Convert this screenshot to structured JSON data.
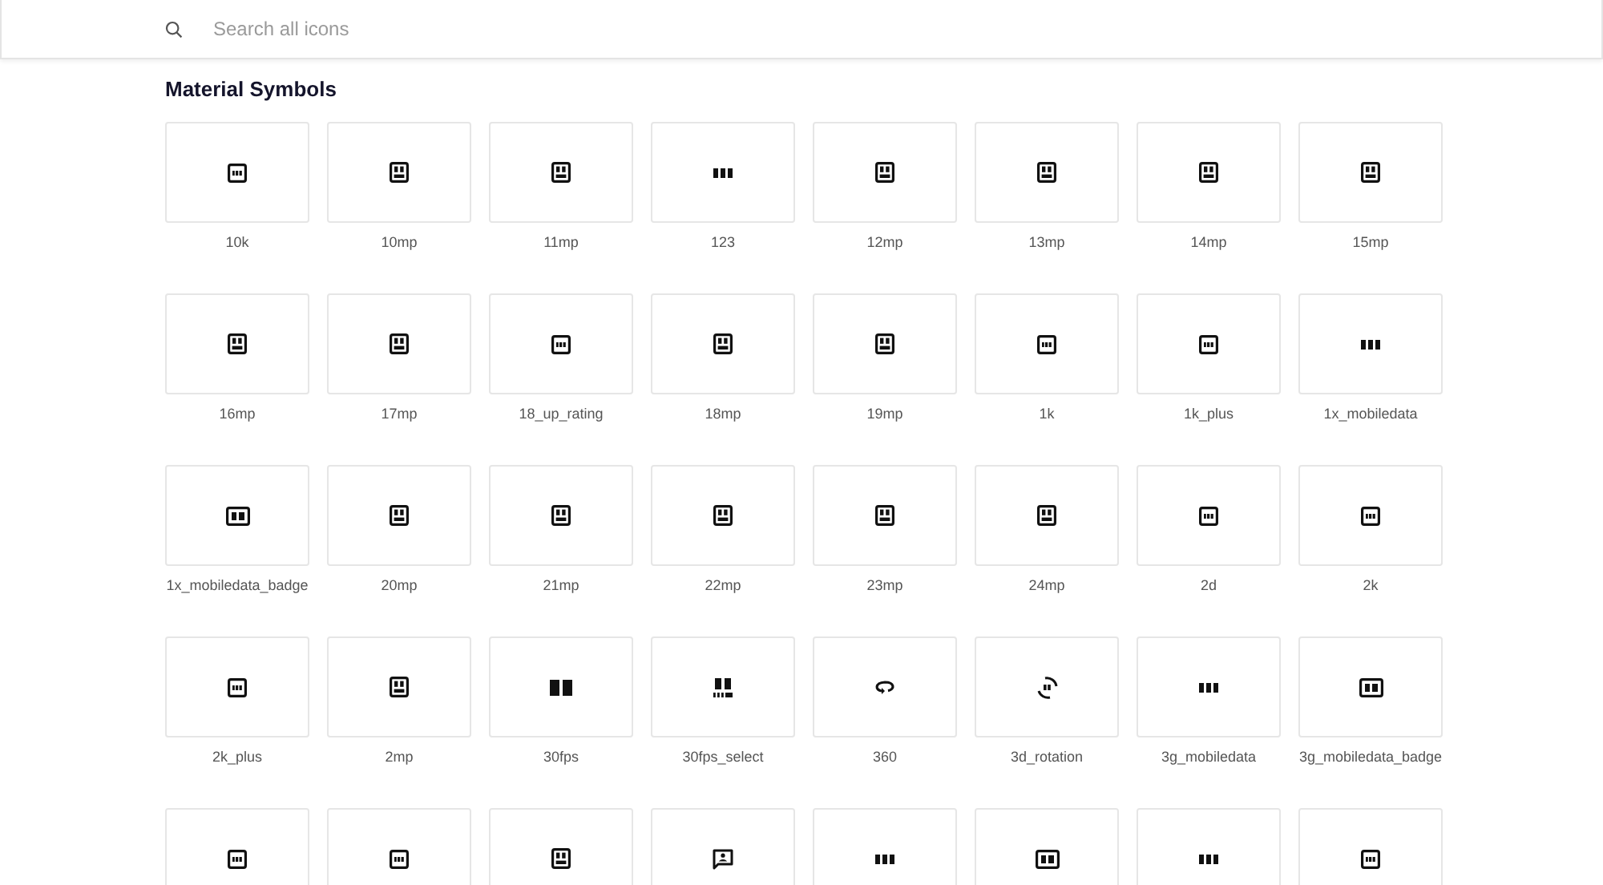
{
  "search": {
    "placeholder": "Search all icons"
  },
  "section": {
    "title": "Material Symbols"
  },
  "icons": [
    {
      "label": "10k",
      "kind": "framed"
    },
    {
      "label": "10mp",
      "kind": "mp"
    },
    {
      "label": "11mp",
      "kind": "mp"
    },
    {
      "label": "123",
      "kind": "plain"
    },
    {
      "label": "12mp",
      "kind": "mp"
    },
    {
      "label": "13mp",
      "kind": "mp"
    },
    {
      "label": "14mp",
      "kind": "mp"
    },
    {
      "label": "15mp",
      "kind": "mp"
    },
    {
      "label": "16mp",
      "kind": "mp"
    },
    {
      "label": "17mp",
      "kind": "mp"
    },
    {
      "label": "18_up_rating",
      "kind": "framed"
    },
    {
      "label": "18mp",
      "kind": "mp"
    },
    {
      "label": "19mp",
      "kind": "mp"
    },
    {
      "label": "1k",
      "kind": "framed"
    },
    {
      "label": "1k_plus",
      "kind": "framed"
    },
    {
      "label": "1x_mobiledata",
      "kind": "plain"
    },
    {
      "label": "1x_mobiledata_badge",
      "kind": "wide"
    },
    {
      "label": "20mp",
      "kind": "mp"
    },
    {
      "label": "21mp",
      "kind": "mp"
    },
    {
      "label": "22mp",
      "kind": "mp"
    },
    {
      "label": "23mp",
      "kind": "mp"
    },
    {
      "label": "24mp",
      "kind": "mp"
    },
    {
      "label": "2d",
      "kind": "framed"
    },
    {
      "label": "2k",
      "kind": "framed"
    },
    {
      "label": "2k_plus",
      "kind": "framed"
    },
    {
      "label": "2mp",
      "kind": "mp"
    },
    {
      "label": "30fps",
      "kind": "bold"
    },
    {
      "label": "30fps_select",
      "kind": "select"
    },
    {
      "label": "360",
      "kind": "orbit"
    },
    {
      "label": "3d_rotation",
      "kind": "rotation"
    },
    {
      "label": "3g_mobiledata",
      "kind": "plain"
    },
    {
      "label": "3g_mobiledata_badge",
      "kind": "wide"
    },
    {
      "kind": "framed"
    },
    {
      "kind": "framed"
    },
    {
      "kind": "mp"
    },
    {
      "kind": "chat"
    },
    {
      "kind": "plain"
    },
    {
      "kind": "wide"
    },
    {
      "kind": "plain"
    },
    {
      "kind": "framed"
    }
  ]
}
